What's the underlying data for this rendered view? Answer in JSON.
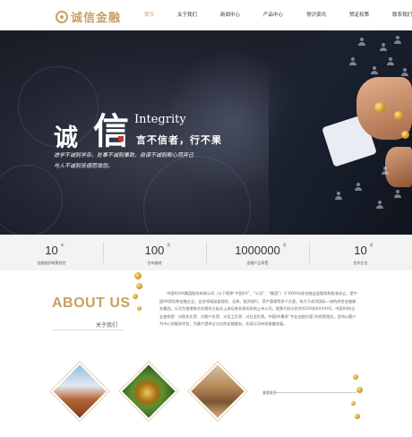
{
  "header": {
    "logo_text": "诚信金融",
    "nav": [
      {
        "label": "首页",
        "active": true
      },
      {
        "label": "关于我们",
        "active": false
      },
      {
        "label": "新闻中心",
        "active": false
      },
      {
        "label": "产品中心",
        "active": false
      },
      {
        "label": "常识资讯",
        "active": false
      },
      {
        "label": "赞定权策",
        "active": false
      },
      {
        "label": "联系我们",
        "active": false
      }
    ]
  },
  "hero": {
    "char1": "诚",
    "char2": "信",
    "integrity": "Integrity",
    "motto": "言不信者，行不果",
    "sub_line1": "进学不诚则学杂，处事不诚则事败，自谋不诚则欺心而弃己",
    "sub_line2": "与人不诚则丧德而增怨。"
  },
  "stats": [
    {
      "num": "10",
      "unit": "年",
      "label": "金融维护政策经验"
    },
    {
      "num": "100",
      "unit": "家",
      "label": "合伙遍地"
    },
    {
      "num": "1000000",
      "unit": "家",
      "label": "金融产品享受"
    },
    {
      "num": "10",
      "unit": "家",
      "label": "合作企业"
    }
  ],
  "about": {
    "title": "ABOUT US",
    "subtitle": "关于我们",
    "text": "中国XXXX集团股份有限公司（以下简称“中国XX”、“公司”、“集团”）于19XX年经金融业监管机构批准成立，是中国XX保险和金融企业，业务领域涵盖保险、证券、投资银行、资产管理等多个方面，致力于成为国际一流的综合金融服务集团。公司为香港联合交易所主板及上海证券交易所两地上市公司，股票代码分别为XXXX和XXXXXX。中国XX的企业使命是：对股东负责、对客户负责、对员工负责、对社会负责。中国XX秉承“专业创造价值”的经营理念，坚持以客户为中心的服务宗旨，为客户提供全方位的金融服务，实现公司持续稳健发展。",
    "more": "查看更多"
  }
}
